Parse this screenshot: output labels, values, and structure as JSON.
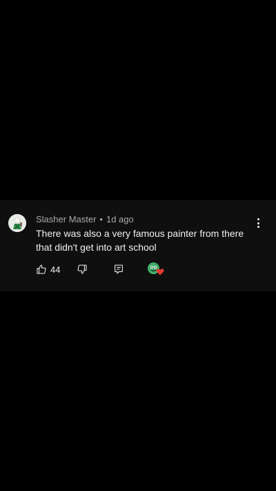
{
  "comment": {
    "author": "Slasher Master",
    "separator": "•",
    "time": "1d ago",
    "text": "There was also a very famous painter from there that didn't get into art school",
    "like_count": "44"
  },
  "icons": {
    "avatar": "user-avatar",
    "more": "more-vertical-icon",
    "like": "thumbs-up-icon",
    "dislike": "thumbs-down-icon",
    "reply": "reply-comment-icon",
    "creator_heart": "creator-heart-icon"
  },
  "colors": {
    "background": "#000000",
    "card": "#0f0f0f",
    "text_primary": "#f1f1f1",
    "text_secondary": "#aaaaaa",
    "heart": "#e53935"
  }
}
